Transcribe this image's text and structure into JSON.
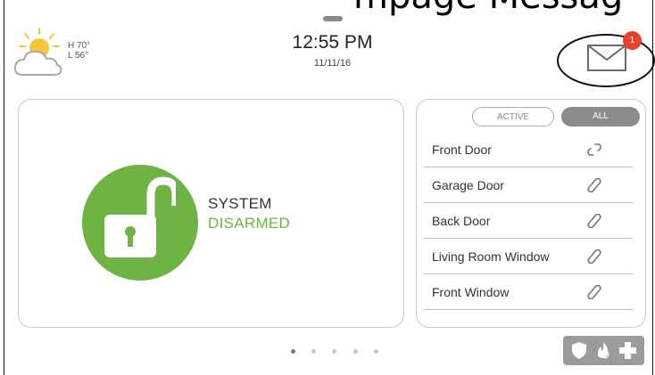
{
  "heading": {
    "text": "mpage Messag"
  },
  "weather": {
    "high": "H 70°",
    "low": "L 56°",
    "icon": "partly-cloudy-icon"
  },
  "clock": {
    "time": "12:55 PM",
    "date": "11/11/16"
  },
  "messages": {
    "unread_count": "1",
    "icon": "envelope-icon"
  },
  "status": {
    "line1": "SYSTEM",
    "line2": "DISARMED",
    "state_color": "#6fb345",
    "icon": "unlocked-padlock-icon"
  },
  "sensor_filter": {
    "tabs": [
      {
        "label": "ACTIVE",
        "selected": false
      },
      {
        "label": "ALL",
        "selected": true
      }
    ]
  },
  "sensors": [
    {
      "name": "Front Door",
      "state": "open"
    },
    {
      "name": "Garage Door",
      "state": "closed"
    },
    {
      "name": "Back Door",
      "state": "closed"
    },
    {
      "name": "Living Room Window",
      "state": "closed"
    },
    {
      "name": "Front Window",
      "state": "closed"
    }
  ],
  "pager": {
    "pages": 5,
    "current": 1
  },
  "emergency": {
    "icons": [
      "shield-icon",
      "fire-icon",
      "medical-cross-icon"
    ]
  },
  "colors": {
    "accent_green": "#6fb345",
    "badge_red": "#e8402f",
    "button_gray": "#9b9b9b"
  }
}
